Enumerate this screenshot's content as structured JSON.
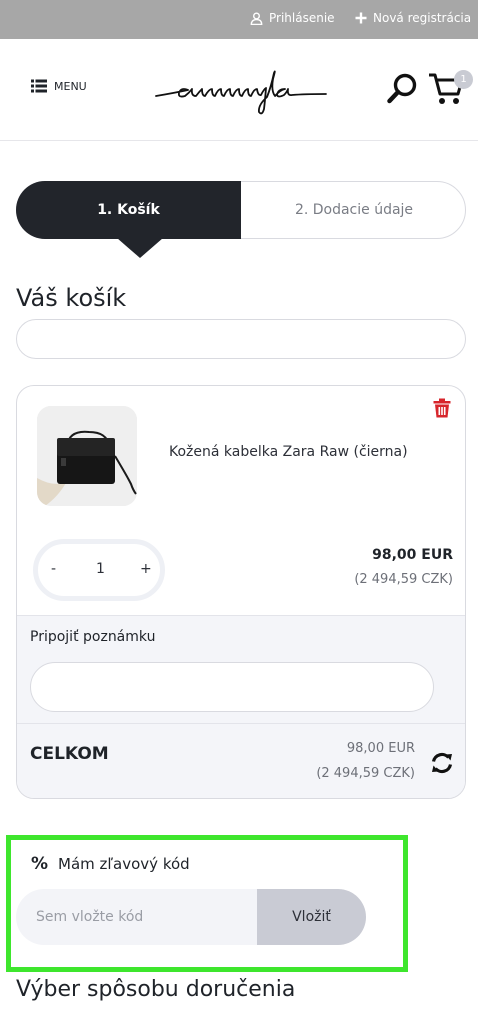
{
  "topbar": {
    "login_label": "Prihlásenie",
    "register_label": "Nová registrácia",
    "icons": [
      "user-icon",
      "plus-icon"
    ]
  },
  "header": {
    "menu_label": "MENU",
    "logo_text": "ammyla",
    "cart_count": "1",
    "icons": [
      "hamburger-icon",
      "search-icon",
      "cart-icon"
    ]
  },
  "steps": {
    "active": "1. Košík",
    "next": "2. Dodacie údaje"
  },
  "cart": {
    "title": "Váš košík",
    "items": [
      {
        "name": "Kožená kabelka Zara Raw (čierna)",
        "quantity": "1",
        "minus": "-",
        "plus": "+",
        "price": "98,00 EUR",
        "price_czk": "(2 494,59 CZK)"
      }
    ],
    "note_label": "Pripojiť poznámku",
    "total_label": "CELKOM",
    "total_price": "98,00 EUR",
    "total_czk": "(2 494,59 CZK)"
  },
  "discount": {
    "label": "Mám zľavový kód",
    "icon": "%",
    "placeholder": "Sem vložte kód",
    "button": "Vložiť"
  },
  "delivery": {
    "title": "Výber spôsobu doručenia"
  },
  "colors": {
    "dark": "#22252b",
    "highlight": "#3ee62d",
    "delete": "#d7262c",
    "topbar": "#a7a7a7"
  }
}
